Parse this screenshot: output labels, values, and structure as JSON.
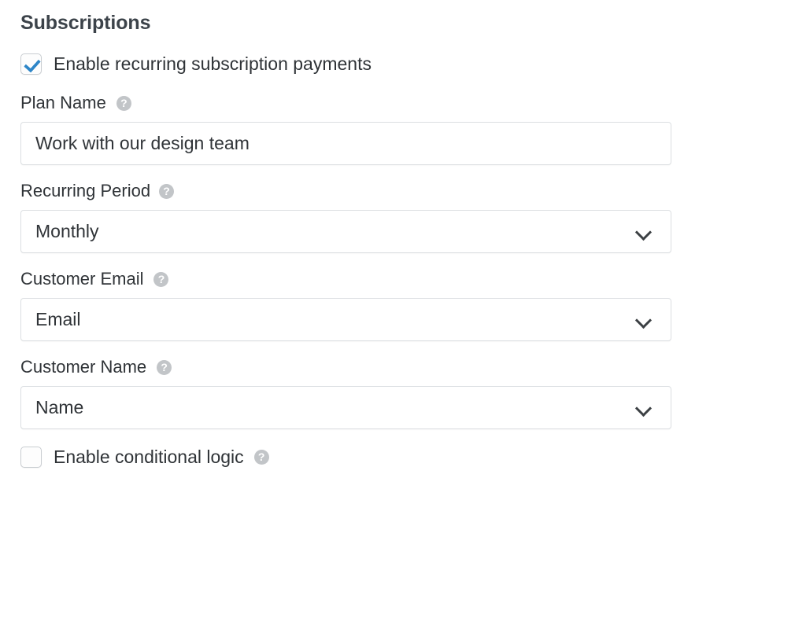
{
  "section": {
    "title": "Subscriptions"
  },
  "enable_recurring": {
    "label": "Enable recurring subscription payments",
    "checked": true,
    "icon": "checkbox-checked-icon"
  },
  "fields": [
    {
      "label": "Plan Name",
      "help_icon": "help-circle-icon",
      "help_glyph": "?",
      "type": "text",
      "value": "Work with our design team",
      "placeholder": "Plan Name"
    },
    {
      "label": "Recurring Period",
      "help_icon": "help-circle-icon",
      "help_glyph": "?",
      "type": "select",
      "value": "Monthly",
      "chevron_icon": "chevron-down-icon"
    },
    {
      "label": "Customer Email",
      "help_icon": "help-circle-icon",
      "help_glyph": "?",
      "type": "select",
      "value": "Email",
      "chevron_icon": "chevron-down-icon"
    },
    {
      "label": "Customer Name",
      "help_icon": "help-circle-icon",
      "help_glyph": "?",
      "type": "select",
      "value": "Name",
      "chevron_icon": "chevron-down-icon"
    }
  ],
  "conditional_logic": {
    "label": "Enable conditional logic",
    "checked": false,
    "icon": "checkbox-unchecked-icon",
    "help_icon": "help-circle-icon",
    "help_glyph": "?"
  },
  "colors": {
    "background": "#ffffff",
    "heading": "#3c434a",
    "text": "#2f3337",
    "checkmark": "#2e86c8",
    "border": "#dcdfe2",
    "help_icon_bg": "#c2c5c8"
  }
}
